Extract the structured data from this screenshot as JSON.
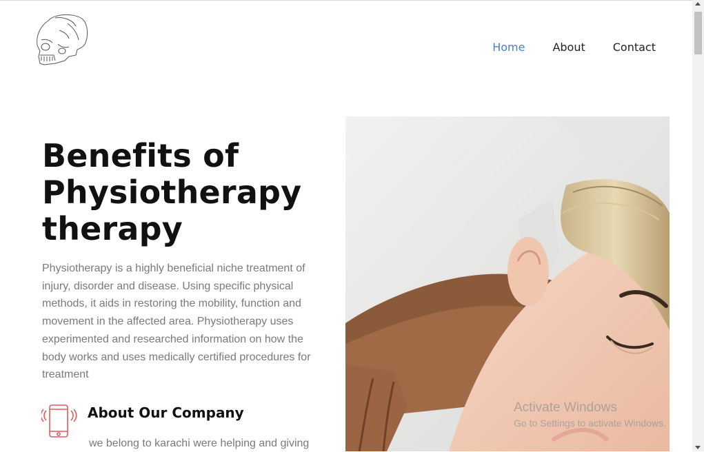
{
  "nav": {
    "items": [
      {
        "label": "Home",
        "active": true
      },
      {
        "label": "About",
        "active": false
      },
      {
        "label": "Contact",
        "active": false
      }
    ],
    "active_color": "#4a7fc9"
  },
  "hero": {
    "title_line1": "Benefits of",
    "title_line2": "Physiotherapy",
    "title_line3": "therapy",
    "description": "Physiotherapy is a highly beneficial niche treatment of injury, disorder and disease. Using specific physical methods, it aids in restoring the mobility, function and movement in the affected area. Physiotherapy uses experimented and researched information on how the body works and uses medically certified procedures for treatment"
  },
  "about": {
    "title": "About Our Company",
    "description": "we belong to karachi were helping and giving",
    "icon": "mobile-phone-icon",
    "icon_color": "#e05a5a"
  },
  "watermark": {
    "title": "Activate Windows",
    "subtitle": "Go to Settings to activate Windows."
  },
  "logo": {
    "icon": "skull-icon"
  },
  "image": {
    "subject": "physiotherapy-massage-photo"
  }
}
